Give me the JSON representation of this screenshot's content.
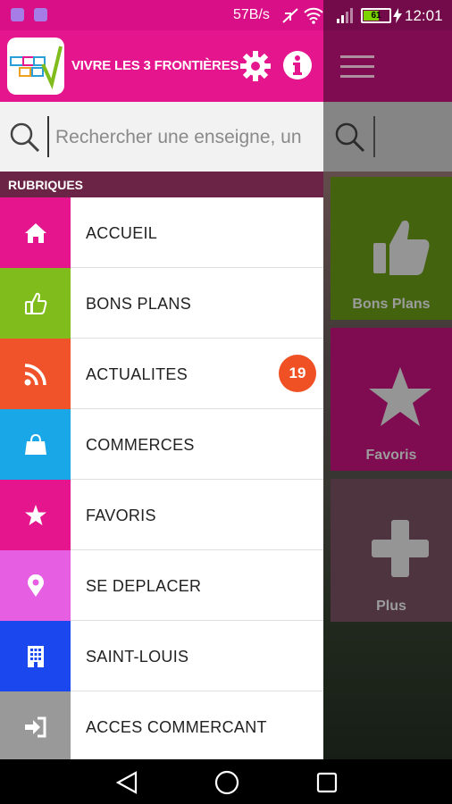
{
  "status_bar": {
    "net_speed": "57B/s",
    "battery_level": "61",
    "battery_fraction": 0.61,
    "time": "12:01"
  },
  "header": {
    "app_title": "VIVRE LES 3 FRONTIÈRES"
  },
  "search": {
    "placeholder": "Rechercher une enseigne, un"
  },
  "section": {
    "label": "RUBRIQUES"
  },
  "menu": {
    "items": [
      {
        "label": "ACCUEIL",
        "color": "#e5158e",
        "icon": "home-icon"
      },
      {
        "label": "BONS PLANS",
        "color": "#80bd1c",
        "icon": "thumbs-up-icon"
      },
      {
        "label": "ACTUALITES",
        "color": "#f0532a",
        "icon": "rss-icon",
        "badge": "19"
      },
      {
        "label": "COMMERCES",
        "color": "#19a7e8",
        "icon": "shopping-bag-icon"
      },
      {
        "label": "FAVORIS",
        "color": "#e5158e",
        "icon": "star-icon"
      },
      {
        "label": "SE DEPLACER",
        "color": "#e65fe3",
        "icon": "map-pin-icon"
      },
      {
        "label": "SAINT-LOUIS",
        "color": "#1b47ef",
        "icon": "building-icon"
      },
      {
        "label": "ACCES COMMERCANT",
        "color": "#999999",
        "icon": "sign-in-icon"
      }
    ]
  },
  "background_tiles": {
    "items": [
      {
        "label": "Bons Plans",
        "color": "#5e8a16",
        "icon": "thumbs-up-icon"
      },
      {
        "label": "Favoris",
        "color": "#b0106f",
        "icon": "star-icon"
      },
      {
        "label": "Plus",
        "color": "#6b4858",
        "icon": "plus-icon"
      }
    ]
  },
  "colors": {
    "brand_pink": "#e5158e",
    "section_bar": "#6b2446",
    "badge": "#ef5124"
  }
}
